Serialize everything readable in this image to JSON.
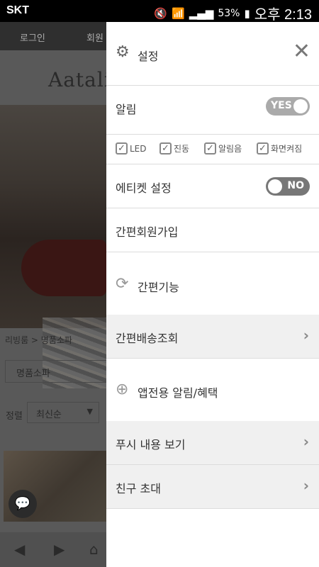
{
  "status_bar": {
    "carrier": "SKT",
    "battery": "53%",
    "time": "오후 2:13"
  },
  "background": {
    "nav_login": "로그인",
    "nav_member": "회원",
    "logo": "Aatalia",
    "breadcrumb": "리빙룸  >  명품소파",
    "category_select": "명품소파",
    "sort_label": "정렬",
    "sort_select": "최신순"
  },
  "drawer": {
    "header_title": "설정",
    "notification": {
      "label": "알림",
      "toggle": "YES"
    },
    "notification_options": [
      {
        "label": "LED",
        "checked": true
      },
      {
        "label": "진동",
        "checked": true
      },
      {
        "label": "알림음",
        "checked": true
      },
      {
        "label": "화면켜짐",
        "checked": true
      }
    ],
    "etiquette": {
      "label": "에티켓 설정",
      "toggle": "NO"
    },
    "signup": "간편회원가입",
    "quick_features_header": "간편기능",
    "delivery_lookup": "간편배송조회",
    "app_benefits_header": "앱전용 알림/혜택",
    "push_view": "푸시 내용 보기",
    "invite_friend": "친구 초대"
  },
  "colors": {
    "drawer_bg": "#ffffff",
    "section_bg": "#f0f0f0",
    "toggle_on": "#aaaaaa",
    "toggle_off": "#777777"
  }
}
